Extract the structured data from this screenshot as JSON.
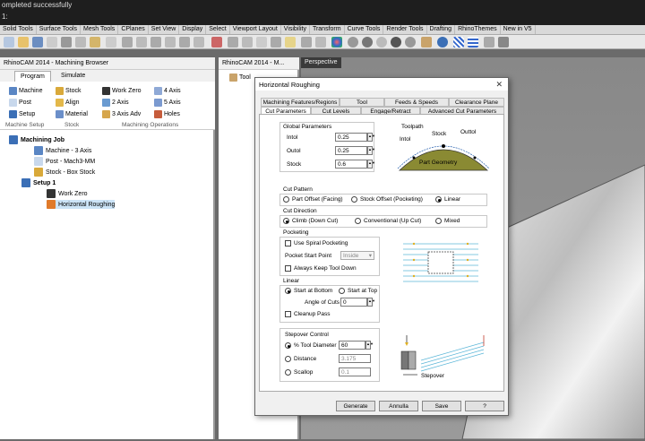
{
  "command": {
    "line1": "ompleted successfully",
    "line2": "1:"
  },
  "toolbar_tabs": [
    "Solid Tools",
    "Surface Tools",
    "Mesh Tools",
    "CPlanes",
    "Set View",
    "Display",
    "Select",
    "Viewport Layout",
    "Visibility",
    "Transform",
    "Curve Tools",
    "Render Tools",
    "Drafting",
    "RhinoThemes",
    "New in V5"
  ],
  "left_pane": {
    "title": "RhinoCAM 2014 - Machining Browser",
    "tabs": [
      "Program",
      "Simulate"
    ],
    "ribbon": {
      "machine": "Machine",
      "post": "Post",
      "setup": "Setup",
      "stock": "Stock",
      "align": "Align",
      "material": "Material",
      "work_zero": "Work Zero",
      "axis2": "2 Axis",
      "axis3_adv": "3 Axis Adv",
      "axis4": "4 Axis",
      "axis5": "5 Axis",
      "holes": "Holes",
      "grp_machine_setup": "Machine Setup",
      "grp_stock": "Stock",
      "grp_machining_ops": "Machining Operations"
    },
    "tree": {
      "job": "Machining Job",
      "machine": "Machine - 3 Axis",
      "post": "Post - Mach3-MM",
      "stock": "Stock - Box Stock",
      "setup": "Setup 1",
      "work_zero": "Work Zero",
      "op": "Horizontal Roughing"
    }
  },
  "mid_pane": {
    "title": "RhinoCAM 2014 - M...",
    "tool_tab": "Tool"
  },
  "viewport": {
    "tab": "Perspective"
  },
  "dialog": {
    "title": "Horizontal Roughing",
    "tabs_row1": [
      "Machining Features/Regions",
      "Tool",
      "Feeds & Speeds",
      "Clearance Plane"
    ],
    "tabs_row2": [
      "Cut Parameters",
      "Cut Levels",
      "Engage/Retract",
      "Advanced Cut Parameters"
    ],
    "global": {
      "header": "Global Parameters",
      "intol_label": "Intol",
      "intol": "0.25",
      "outtol_label": "Outol",
      "outtol": "0.25",
      "stock_label": "Stock",
      "stock": "0.6",
      "diag_toolpath": "Toolpath",
      "diag_intol": "Intol",
      "diag_stock": "Stock",
      "diag_outtol": "Outtol",
      "diag_part": "Part Geometry"
    },
    "cut_pattern": {
      "header": "Cut Pattern",
      "opt1": "Part Offset (Facing)",
      "opt2": "Stock Offset (Pocketing)",
      "opt3": "Linear"
    },
    "cut_direction": {
      "header": "Cut Direction",
      "opt1": "Climb (Down Cut)",
      "opt2": "Conventional (Up Cut)",
      "opt3": "Mixed"
    },
    "pocketing": {
      "header": "Pocketing",
      "spiral": "Use Spiral Pocketing",
      "start_point_label": "Pocket Start Point",
      "start_point": "Inside",
      "keep_down": "Always Keep Tool Down"
    },
    "linear": {
      "header": "Linear",
      "start_bottom": "Start at Bottom",
      "start_top": "Start at Top",
      "angle_label": "Angle of Cuts",
      "angle": "0",
      "cleanup": "Cleanup Pass"
    },
    "stepover": {
      "header": "Stepover Control",
      "pct_label": "% Tool Diameter",
      "pct": "60",
      "dist_label": "Distance",
      "dist": "3.175",
      "scallop_label": "Scallop",
      "scallop": "0.1",
      "diag": "Stepover"
    },
    "buttons": {
      "generate": "Generate",
      "cancel": "Annulla",
      "save": "Save",
      "help": "?"
    }
  },
  "colors": {
    "accent": "#3b6fb6",
    "part": "#8a8a33",
    "highlight": "#cce4f7"
  }
}
